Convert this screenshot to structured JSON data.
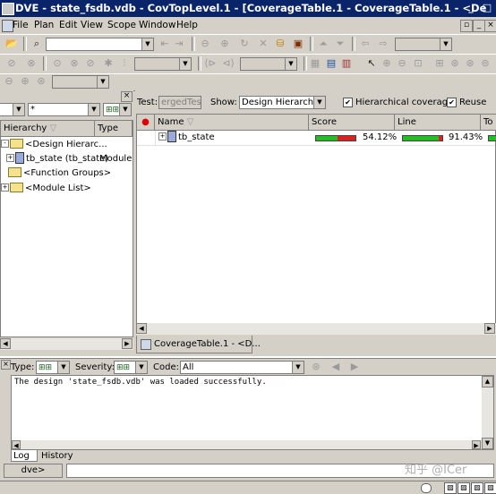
{
  "window": {
    "title": "DVE - state_fsdb.vdb -  CovTopLevel.1 - [CoverageTable.1 - CoverageTable.1 - <De"
  },
  "menu": [
    "File",
    "Plan",
    "Edit",
    "View",
    "Scope",
    "Window",
    "Help"
  ],
  "left_panel": {
    "filter_value": "*",
    "columns": [
      "Hierarchy",
      "Type"
    ],
    "tree": [
      {
        "label": "<Design Hierarc...",
        "type": ""
      },
      {
        "label": "tb_state (tb_state)",
        "type": "Module"
      },
      {
        "label": "<Function Groups>",
        "type": ""
      },
      {
        "label": "<Module List>",
        "type": ""
      }
    ]
  },
  "coverage": {
    "test_label": "Test:",
    "test_value": "ergedTest",
    "show_label": "Show:",
    "show_value": "Design Hierarchy",
    "hier_cov_label": "Hierarchical coverage",
    "hier_cov_checked": true,
    "reuse_label": "Reuse",
    "reuse_checked": true,
    "columns": [
      "Name",
      "Score",
      "Line",
      "To"
    ],
    "rows": [
      {
        "name": "tb_state",
        "score": "54.12%",
        "score_pct": 54.12,
        "line": "91.43%",
        "line_pct": 91.43
      }
    ],
    "tab_label": "CoverageTable.1 - <D..."
  },
  "console": {
    "type_label": "Type:",
    "severity_label": "Severity:",
    "code_label": "Code:",
    "code_value": "All",
    "message": "The design 'state_fsdb.vdb' was loaded successfully.",
    "tabs": [
      "Log",
      "History"
    ],
    "prompt": "dve>"
  },
  "watermark": "知乎 @ICer",
  "colors": {
    "title_bg": "#0a246a",
    "good": "#20c020",
    "bad": "#e02020"
  }
}
